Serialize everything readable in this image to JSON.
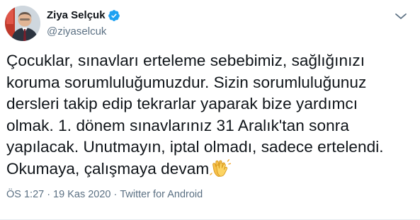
{
  "author": {
    "display_name": "Ziya Selçuk",
    "handle": "@ziyaselcuk",
    "verified": true,
    "avatar_icon": "profile-photo"
  },
  "tweet": {
    "lines": [
      "Çocuklar, sınavları erteleme sebebimiz, sağlığınızı",
      "koruma sorumluluğumuzdur. Sizin sorumluluğunuz",
      "dersleri takip edip tekrarlar yaparak bize yardımcı",
      "olmak. 1. dönem sınavlarınız 31 Aralık'tan sonra",
      "yapılacak. Unutmayın, iptal olmadı, sadece ertelendi.",
      "Okumaya, çalışmaya devam"
    ],
    "emoji": "clapping-hands-emoji"
  },
  "meta": {
    "time": "ÖS 1:27",
    "separator": "·",
    "date": "19 Kas 2020",
    "source": "Twitter for Android"
  },
  "colors": {
    "text": "#0f1419",
    "secondary": "#5b7083",
    "verified_badge": "#1da1f2"
  }
}
